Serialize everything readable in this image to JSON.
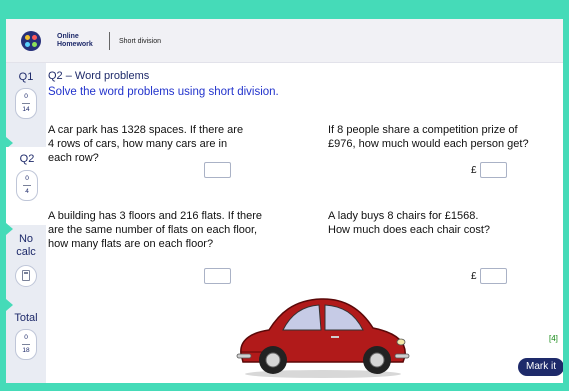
{
  "header": {
    "brand_line1": "Online",
    "brand_line2": "Homework",
    "breadcrumb": "Short division"
  },
  "sidebar": {
    "items": [
      {
        "label": "Q1",
        "score": "0",
        "total": "14",
        "active": false
      },
      {
        "label": "Q2",
        "score": "0",
        "total": "4",
        "active": true
      },
      {
        "label_line1": "No",
        "label_line2": "calc",
        "icon": "calculator-icon"
      },
      {
        "label": "Total",
        "score": "0",
        "total": "18"
      }
    ]
  },
  "main": {
    "question_title": "Q2 – Word problems",
    "instruction": "Solve the word problems using short division.",
    "problems": [
      {
        "lines": [
          "A car park has 1328 spaces. If there are",
          "4 rows of cars, how many cars are in",
          "each row?"
        ],
        "answer": "",
        "prefix": ""
      },
      {
        "lines": [
          "If 8 people share a competition prize of",
          "£976, how much would each person get?"
        ],
        "answer": "",
        "prefix": "£"
      },
      {
        "lines": [
          "A building has 3 floors and 216 flats. If there",
          "are the same number of flats on each floor,",
          "how many flats are on each floor?"
        ],
        "answer": "",
        "prefix": ""
      },
      {
        "lines": [
          "A lady buys 8 chairs for £1568.",
          "How much does each chair cost?"
        ],
        "answer": "",
        "prefix": "£"
      }
    ],
    "image": "red-car-illustration",
    "marks": "[4]",
    "mark_button": "Mark it"
  },
  "colors": {
    "accent": "#45dbb8",
    "navy": "#1e2a6a",
    "instruction_blue": "#2233cc",
    "marks_green": "#118811",
    "car_red": "#b11a1a"
  }
}
